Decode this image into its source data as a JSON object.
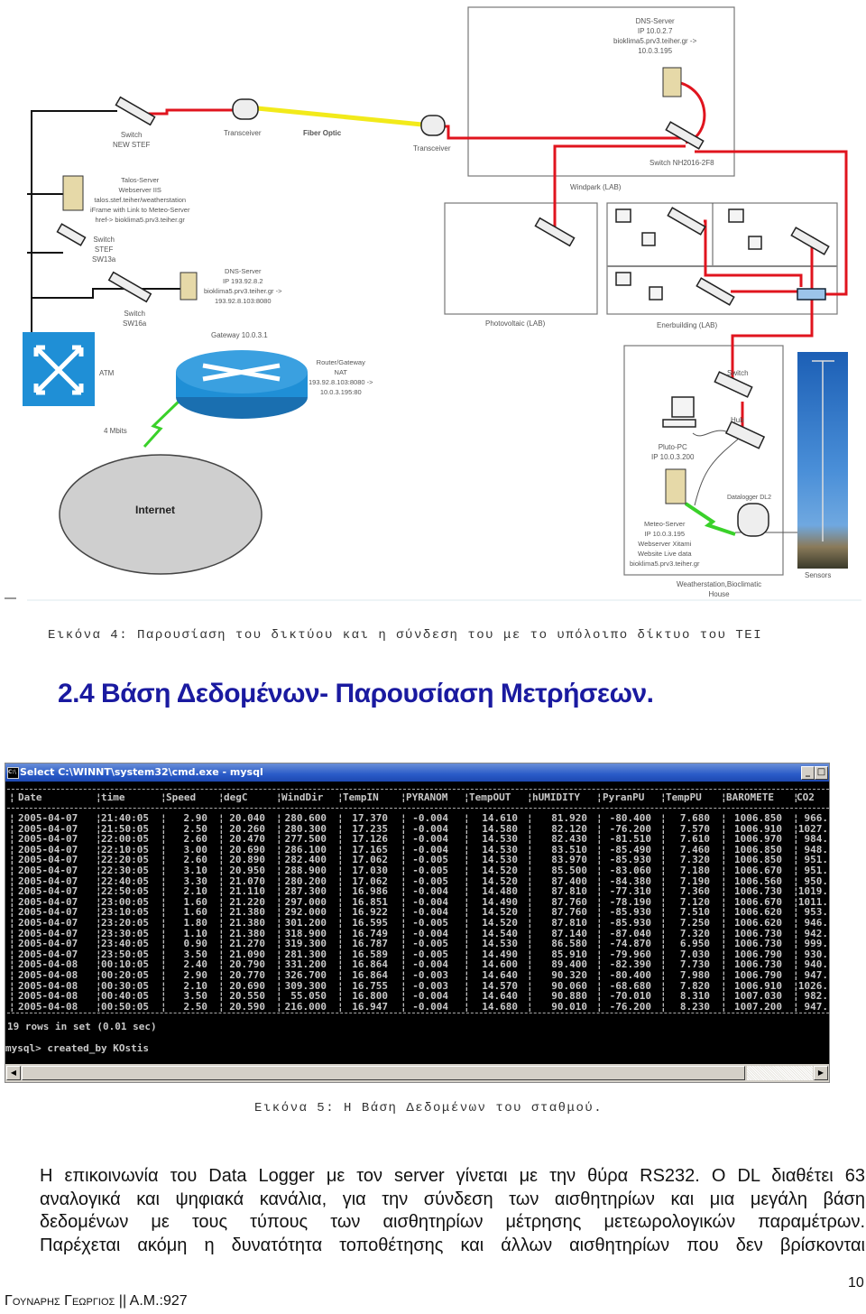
{
  "diagram": {
    "labels": {
      "switch_new_stef": [
        "Switch",
        "NEW STEF"
      ],
      "transceiver_left": "Transceiver",
      "fiber_optic": "Fiber Optic",
      "transceiver_right": "Transceiver",
      "talos_server": [
        "Talos-Server",
        "Webserver IIS",
        "talos.stef.teiher/weatherstation",
        "iFrame with Link to Meteo-Server",
        "href-> bioklima5.prv3.teiher.gr"
      ],
      "switch_stef": [
        "Switch",
        "STEF",
        "SW13a"
      ],
      "switch_sw16a": [
        "Switch",
        "SW16a"
      ],
      "dns_server_left": [
        "DNS-Server",
        "IP 193.92.8.2",
        "bioklima5.prv3.teiher.gr ->",
        "193.92.8.103:8080"
      ],
      "gateway": "Gateway 10.0.3.1",
      "atm": "ATM",
      "router": [
        "Router/Gateway",
        "NAT",
        "193.92.8.103:8080 ->",
        "10.0.3.195:80"
      ],
      "bandwidth": "4 Mbits",
      "internet": "Internet",
      "dns_server_right": [
        "DNS-Server",
        "IP 10.0.2.7",
        "bioklima5.prv3.teiher.gr ->",
        "10.0.3.195"
      ],
      "switch_nh": "Switch NH2016-2F8",
      "windpark": "Windpark (LAB)",
      "photovoltaic": "Photovoltaic (LAB)",
      "enerbuilding": "Enerbuilding (LAB)",
      "switch_ws": "Switch",
      "hub": "Hub",
      "pluto_pc": [
        "Pluto-PC",
        "IP 10.0.3.200"
      ],
      "meteo_server": [
        "Meteo-Server",
        "IP 10.0.3.195",
        "Webserver Xitami",
        "Website Live data",
        "bioklima5.prv3.teiher.gr"
      ],
      "datalogger": "Datalogger DL2",
      "sensors": "Sensors",
      "weatherstation": [
        "Weatherstation,Bioclimatic",
        "House"
      ]
    },
    "colors": {
      "ethernet": "#e0141e",
      "fiber": "#f2ea1a",
      "wireless": "#3ad12a",
      "cisco_blue": "#1f8fd6"
    }
  },
  "caption_fig4": "Εικόνα 4: Παρουσίαση  του δικτύου και η σύνδεση του με το υπόλοιπο δίκτυο του ΤΕΙ",
  "section_heading": "2.4 Βάση Δεδομένων- Παρουσίαση Μετρήσεων.",
  "console": {
    "title": "Select C:\\WINNT\\system32\\cmd.exe - mysql",
    "icon": "C:\\",
    "minimize": "_",
    "maximize": "□",
    "columns": [
      "Date",
      "time",
      "Speed",
      "degC",
      "WindDir",
      "TempIN",
      "PYRANOM",
      "TempOUT",
      "hUMIDITY",
      "PyranPU",
      "TempPU",
      "BAROMETE",
      "CO2"
    ],
    "rows": [
      [
        "2005-04-07",
        "21:40:05",
        "2.90",
        "20.040",
        "280.600",
        "17.370",
        "-0.004",
        "14.610",
        "81.920",
        "-80.400",
        "7.680",
        "1006.850",
        "966."
      ],
      [
        "2005-04-07",
        "21:50:05",
        "2.50",
        "20.260",
        "280.300",
        "17.235",
        "-0.004",
        "14.580",
        "82.120",
        "-76.200",
        "7.570",
        "1006.910",
        "1027."
      ],
      [
        "2005-04-07",
        "22:00:05",
        "2.60",
        "20.470",
        "277.500",
        "17.126",
        "-0.004",
        "14.530",
        "82.430",
        "-81.510",
        "7.610",
        "1006.970",
        "984."
      ],
      [
        "2005-04-07",
        "22:10:05",
        "3.00",
        "20.690",
        "286.100",
        "17.165",
        "-0.004",
        "14.530",
        "83.510",
        "-85.490",
        "7.460",
        "1006.850",
        "948."
      ],
      [
        "2005-04-07",
        "22:20:05",
        "2.60",
        "20.890",
        "282.400",
        "17.062",
        "-0.005",
        "14.530",
        "83.970",
        "-85.930",
        "7.320",
        "1006.850",
        "951."
      ],
      [
        "2005-04-07",
        "22:30:05",
        "3.10",
        "20.950",
        "288.900",
        "17.030",
        "-0.005",
        "14.520",
        "85.500",
        "-83.060",
        "7.180",
        "1006.670",
        "951."
      ],
      [
        "2005-04-07",
        "22:40:05",
        "3.30",
        "21.070",
        "280.200",
        "17.062",
        "-0.005",
        "14.520",
        "87.400",
        "-84.380",
        "7.190",
        "1006.560",
        "950."
      ],
      [
        "2005-04-07",
        "22:50:05",
        "2.10",
        "21.110",
        "287.300",
        "16.986",
        "-0.004",
        "14.480",
        "87.810",
        "-77.310",
        "7.360",
        "1006.730",
        "1019."
      ],
      [
        "2005-04-07",
        "23:00:05",
        "1.60",
        "21.220",
        "297.000",
        "16.851",
        "-0.004",
        "14.490",
        "87.760",
        "-78.190",
        "7.120",
        "1006.670",
        "1011."
      ],
      [
        "2005-04-07",
        "23:10:05",
        "1.60",
        "21.380",
        "292.000",
        "16.922",
        "-0.004",
        "14.520",
        "87.760",
        "-85.930",
        "7.510",
        "1006.620",
        "953."
      ],
      [
        "2005-04-07",
        "23:20:05",
        "1.80",
        "21.380",
        "301.200",
        "16.595",
        "-0.005",
        "14.520",
        "87.810",
        "-85.930",
        "7.250",
        "1006.620",
        "946."
      ],
      [
        "2005-04-07",
        "23:30:05",
        "1.10",
        "21.380",
        "318.900",
        "16.749",
        "-0.004",
        "14.540",
        "87.140",
        "-87.040",
        "7.320",
        "1006.730",
        "942."
      ],
      [
        "2005-04-07",
        "23:40:05",
        "0.90",
        "21.270",
        "319.300",
        "16.787",
        "-0.005",
        "14.530",
        "86.580",
        "-74.870",
        "6.950",
        "1006.730",
        "999."
      ],
      [
        "2005-04-07",
        "23:50:05",
        "3.50",
        "21.090",
        "281.300",
        "16.589",
        "-0.005",
        "14.490",
        "85.910",
        "-79.960",
        "7.030",
        "1006.790",
        "930."
      ],
      [
        "2005-04-08",
        "00:10:05",
        "2.40",
        "20.790",
        "331.200",
        "16.864",
        "-0.004",
        "14.600",
        "89.400",
        "-82.390",
        "7.730",
        "1006.730",
        "940."
      ],
      [
        "2005-04-08",
        "00:20:05",
        "2.90",
        "20.770",
        "326.700",
        "16.864",
        "-0.003",
        "14.640",
        "90.320",
        "-80.400",
        "7.980",
        "1006.790",
        "947."
      ],
      [
        "2005-04-08",
        "00:30:05",
        "2.10",
        "20.690",
        "309.300",
        "16.755",
        "-0.003",
        "14.570",
        "90.060",
        "-68.680",
        "7.820",
        "1006.910",
        "1026."
      ],
      [
        "2005-04-08",
        "00:40:05",
        "3.50",
        "20.550",
        "55.050",
        "16.800",
        "-0.004",
        "14.640",
        "90.880",
        "-70.010",
        "8.310",
        "1007.030",
        "982."
      ],
      [
        "2005-04-08",
        "00:50:05",
        "2.50",
        "20.590",
        "216.000",
        "16.947",
        "-0.004",
        "14.680",
        "90.010",
        "-76.200",
        "8.230",
        "1007.200",
        "947."
      ]
    ],
    "result_line": "19 rows in set (0.01 sec)",
    "prompt_line": "mysql> created_by KOstis"
  },
  "caption_fig5": "Εικόνα 5: Η Βάση Δεδομένων του σταθμού.",
  "paragraph_lines": [
    "Η επικοινωνία  του Data Logger με τον server γίνεται με την θύρα RS232. Ο DL διαθέτει 63",
    "αναλογικά και ψηφιακά κανάλια, για την σύνδεση των αισθητηρίων και μια μεγάλη βάση",
    "δεδομένων με τους τύπους των αισθητηρίων μέτρησης μετεωρολογικών παραμέτρων.",
    "Παρέχεται ακόμη η δυνατότητα τοποθέτησης και άλλων αισθητηρίων που δεν βρίσκονται"
  ],
  "footer": {
    "author": "Γουναρης Γεωργιος || Α.Μ.:927",
    "page_number": "10"
  }
}
